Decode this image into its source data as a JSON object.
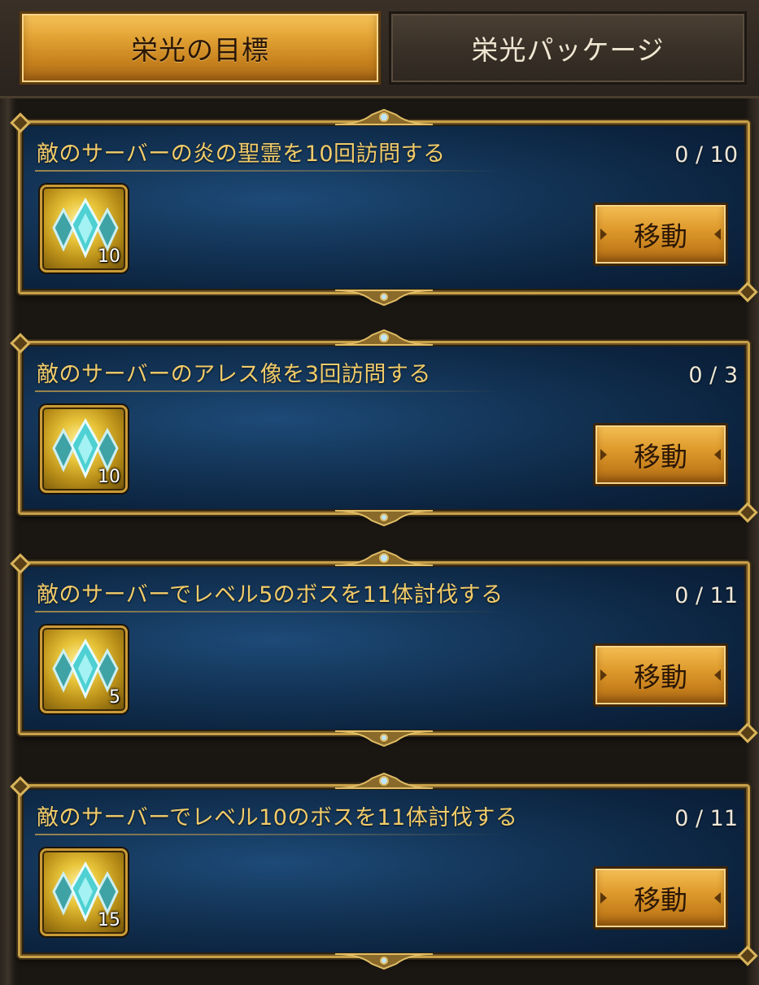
{
  "tabs": [
    {
      "label": "栄光の目標",
      "active": true
    },
    {
      "label": "栄光パッケージ",
      "active": false
    }
  ],
  "quests": [
    {
      "title": "敵のサーバーの炎の聖霊を10回訪問する",
      "progress": "0 / 10",
      "reward_icon": "crystal-icon",
      "reward_count": "10",
      "button_label": "移動"
    },
    {
      "title": "敵のサーバーのアレス像を3回訪問する",
      "progress": "0 / 3",
      "reward_icon": "crystal-icon",
      "reward_count": "10",
      "button_label": "移動"
    },
    {
      "title": "敵のサーバーでレベル5のボスを11体討伐する",
      "progress": "0 / 11",
      "reward_icon": "crystal-icon",
      "reward_count": "5",
      "button_label": "移動"
    },
    {
      "title": "敵のサーバーでレベル10のボスを11体討伐する",
      "progress": "0 / 11",
      "reward_icon": "crystal-icon",
      "reward_count": "15",
      "button_label": "移動"
    }
  ],
  "colors": {
    "accent_gold": "#e2a234",
    "title_text": "#f2cc6a",
    "card_blue": "#143659"
  }
}
